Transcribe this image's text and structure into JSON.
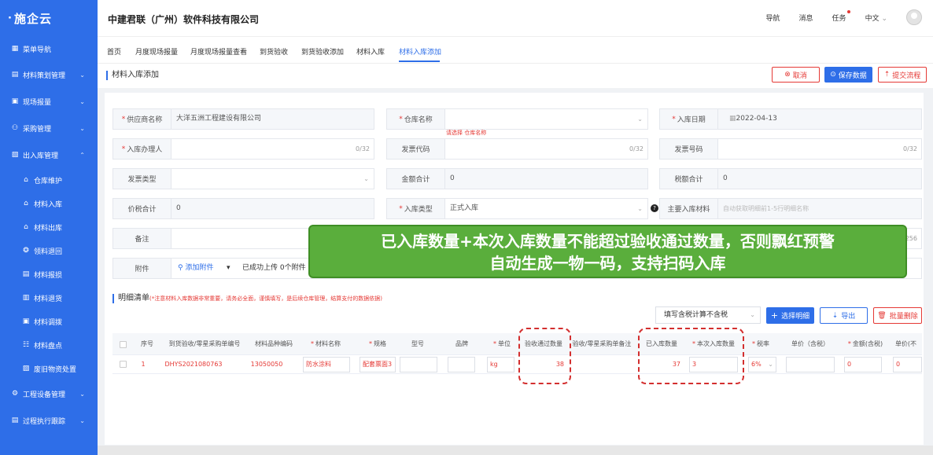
{
  "sidebar": {
    "logo": "施企云",
    "items": [
      {
        "label": "菜单导航",
        "icon": "grid-icon"
      },
      {
        "label": "材料策划管理",
        "icon": "doc-icon"
      },
      {
        "label": "现场报量",
        "icon": "chart-icon"
      },
      {
        "label": "采购管理",
        "icon": "tree-icon"
      },
      {
        "label": "出入库管理",
        "icon": "box-icon"
      },
      {
        "label": "仓库维护",
        "icon": "house-icon"
      },
      {
        "label": "材料入库",
        "icon": "house-in-icon"
      },
      {
        "label": "材料出库",
        "icon": "house-out-icon"
      },
      {
        "label": "领料退回",
        "icon": "return-icon"
      },
      {
        "label": "材料报损",
        "icon": "list-icon"
      },
      {
        "label": "材料退货",
        "icon": "list-back-icon"
      },
      {
        "label": "材料调拨",
        "icon": "swap-icon"
      },
      {
        "label": "材料盘点",
        "icon": "stack-icon"
      },
      {
        "label": "废旧物资处置",
        "icon": "recycle-icon"
      },
      {
        "label": "工程设备管理",
        "icon": "gear-icon"
      },
      {
        "label": "过程执行跟踪",
        "icon": "track-icon"
      }
    ]
  },
  "header": {
    "company": "中建君联（广州）软件科技有限公司",
    "nav": "导航",
    "messages": "消息",
    "tasks": "任务",
    "lang": "中文"
  },
  "tabs": [
    "首页",
    "月度现场报量",
    "月度现场报量查看",
    "到货验收",
    "到货验收添加",
    "材料入库",
    "材料入库添加"
  ],
  "page": {
    "title": "材料入库添加",
    "cancel": "取消",
    "save": "保存数据",
    "submit": "提交流程"
  },
  "form": {
    "supplier_label": "供应商名称",
    "supplier_value": "大洋五洲工程建设有限公司",
    "warehouse_label": "仓库名称",
    "warehouse_error": "请选择 仓库名称",
    "date_label": "入库日期",
    "date_value": "2022-04-13",
    "handler_label": "入库办理人",
    "handler_count": "0/32",
    "invoice_code_label": "发票代码",
    "invoice_code_count": "0/32",
    "invoice_no_label": "发票号码",
    "invoice_no_count": "0/32",
    "invoice_type_label": "发票类型",
    "amount_label": "金额合计",
    "amount_value": "0",
    "tax_label": "税额合计",
    "tax_value": "0",
    "total_label": "价税合计",
    "total_value": "0",
    "in_type_label": "入库类型",
    "in_type_value": "正式入库",
    "main_material_label": "主要入库材料",
    "main_material_ph": "自动获取明细前1-5行明细名称",
    "remark_label": "备注",
    "remark_count": "256",
    "attach_label": "附件",
    "attach_add": "添加附件",
    "attach_status": "已成功上传 0个附件"
  },
  "detail": {
    "title": "明细清单",
    "note": "(*注意材料入库数据非常重要，请务必全面，谨慎填写，是后续仓库管理，结算支付的数据依据)",
    "tax_mode": "填写含税计算不含税",
    "choose": "选择明细",
    "export": "导出",
    "batch_delete": "批量删除",
    "columns": [
      "序号",
      "到货验收/零星采购单编号",
      "材料品种编码",
      "材料名称",
      "规格",
      "型号",
      "品牌",
      "单位",
      "验收通过数量",
      "验收/零星采购单备注",
      "已入库数量",
      "本次入库数量",
      "税率",
      "单价（含税）",
      "金额(含税)",
      "单价(不"
    ],
    "rows": [
      {
        "no": "1",
        "order": "DHYS2021080763",
        "code": "13050050",
        "name": "防水涂料",
        "spec": "配套票面3",
        "model": "",
        "brand": "",
        "unit": "kg",
        "accepted": "38",
        "remark": "",
        "stocked": "37",
        "current": "3",
        "tax_rate": "6%",
        "price": "",
        "amount": "0",
        "price_ex": "0"
      }
    ]
  },
  "banner": {
    "line1": "已入库数量+本次入库数量不能超过验收通过数量，否则飘红预警",
    "line2": "自动生成一物一码，支持扫码入库"
  },
  "colors": {
    "primary": "#2e6ee8",
    "danger": "#e53935",
    "banner": "#5aae3c"
  }
}
